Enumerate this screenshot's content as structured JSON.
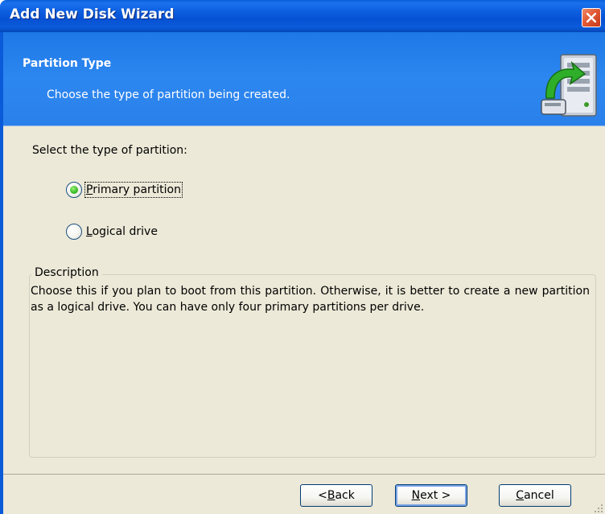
{
  "window": {
    "title": "Add New Disk Wizard",
    "close_icon": "close-icon",
    "accent_color": "#0a5bd9"
  },
  "header": {
    "title": "Partition Type",
    "subtitle": "Choose the type of partition being created.",
    "icon": "disk-drive-wizard-icon"
  },
  "content": {
    "prompt": "Select the type of partition:",
    "options": [
      {
        "label_mnemonic": "P",
        "label_rest": "rimary partition",
        "selected": true
      },
      {
        "label_mnemonic": "L",
        "label_rest": "ogical drive",
        "selected": false
      }
    ],
    "description": {
      "legend": "Description",
      "text": "Choose this if you plan to boot from this partition. Otherwise, it is better to create a new partition as a logical drive. You can have only four primary partitions per drive."
    }
  },
  "footer": {
    "back": {
      "prefix": "< ",
      "mnemonic": "B",
      "rest": "ack"
    },
    "next": {
      "mnemonic": "N",
      "rest": "ext >"
    },
    "cancel": {
      "mnemonic": "C",
      "rest": "ancel"
    }
  }
}
